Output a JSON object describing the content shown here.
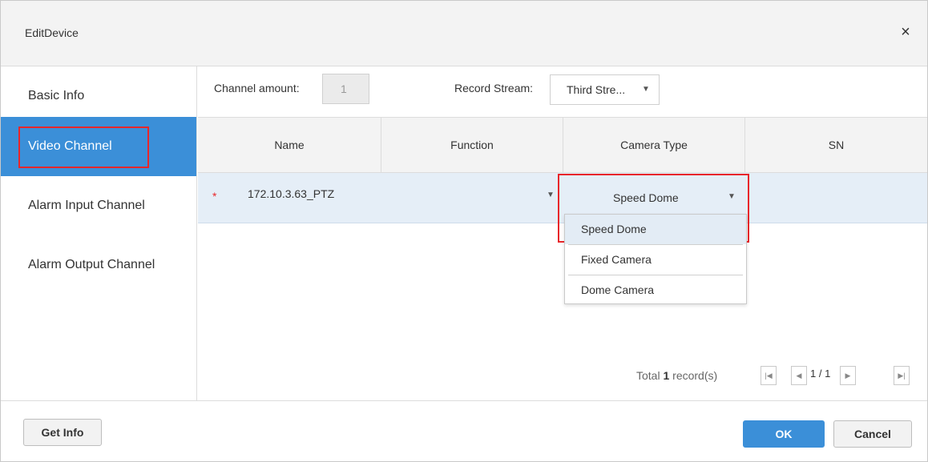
{
  "dialog": {
    "title": "EditDevice",
    "close_symbol": "×"
  },
  "sidebar": {
    "items": [
      {
        "label": "Basic Info",
        "active": false
      },
      {
        "label": "Video Channel",
        "active": true
      },
      {
        "label": "Alarm Input Channel",
        "active": false
      },
      {
        "label": "Alarm Output Channel",
        "active": false
      }
    ]
  },
  "toolbar": {
    "channel_amount_label": "Channel amount:",
    "channel_amount_value": "1",
    "record_stream_label": "Record Stream:",
    "record_stream_value": "Third Stre..."
  },
  "table": {
    "columns": [
      "Name",
      "Function",
      "Camera Type",
      "SN"
    ],
    "rows": [
      {
        "required_mark": "*",
        "name": "172.10.3.63_PTZ",
        "function": "",
        "camera_type": "Speed Dome",
        "sn": ""
      }
    ]
  },
  "camera_type_dropdown": {
    "options": [
      "Speed Dome",
      "Fixed Camera",
      "Dome Camera"
    ],
    "selected": "Speed Dome"
  },
  "pager": {
    "total_prefix": "Total",
    "total_count": "1",
    "total_suffix": "record(s)",
    "page_info": "1 / 1"
  },
  "footer": {
    "get_info_label": "Get Info",
    "ok_label": "OK",
    "cancel_label": "Cancel"
  },
  "colors": {
    "accent": "#3b8fd8",
    "highlight_border": "#e8262a",
    "selected_row": "#e5eef7"
  }
}
